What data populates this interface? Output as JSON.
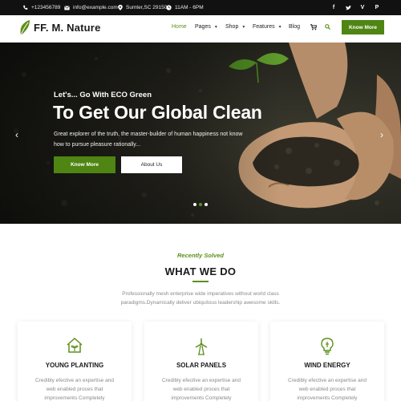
{
  "topbar": {
    "phone": "+123456789",
    "email": "info@example.com",
    "location": "Sumter,SC 29150",
    "hours": "11AM - 6PM",
    "social": [
      "facebook-icon",
      "twitter-icon",
      "vimeo-icon",
      "pinterest-icon"
    ]
  },
  "header": {
    "logo": "FF. M. Nature",
    "nav": [
      {
        "label": "Home",
        "active": true
      },
      {
        "label": "Pages",
        "dropdown": true
      },
      {
        "label": "Shop",
        "dropdown": true
      },
      {
        "label": "Features",
        "dropdown": true
      },
      {
        "label": "Blog"
      }
    ],
    "cta": "Know More"
  },
  "hero": {
    "kicker": "Let's... Go With ECO Green",
    "title": "To Get Our Global Clean",
    "description": "Great explorer of the truth, the master-builder of human happiness not know how to pursue pleasure rationally...",
    "primary_button": "Know More",
    "secondary_button": "About Us",
    "slides": 3,
    "active_slide": 2
  },
  "section": {
    "kicker": "Recently Solved",
    "title": "WHAT WE DO",
    "description": "Professionally mesh enterprise wide imperatives without world class paradigms.Dynamically deliver ubiquitous leadership awesome skills."
  },
  "cards": [
    {
      "title": "YOUNG PLANTING",
      "description": "Credibly efective an expertise and web enabled proces that improvements Completely"
    },
    {
      "title": "SOLAR PANELS",
      "description": "Credibly efective an expertise and web enabled proces that improvements Completely"
    },
    {
      "title": "WIND ENERGY",
      "description": "Credibly efective an expertise and web enabled proces that improvements Completely"
    }
  ],
  "colors": {
    "accent": "#4e8513",
    "topbar": "#111111"
  }
}
